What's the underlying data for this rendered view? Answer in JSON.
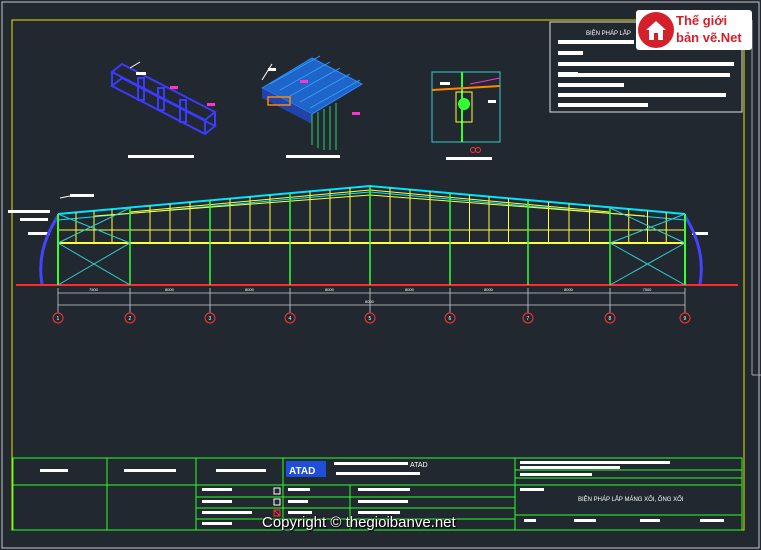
{
  "logo": {
    "line1": "Thế giới",
    "line2": "bản vẽ.Net"
  },
  "notes": {
    "title": "BIỆN PHÁP LẮP"
  },
  "titleblock": {
    "company": "ATAD",
    "stamp": "ATAD",
    "drawing_title": "BIỆN PHÁP LẮP MÁNG XỐI, ỐNG XỐI"
  },
  "watermark": "Copyright © thegioibanve.net",
  "elevation": {
    "total_dim": "8000",
    "bay_dims": [
      "7500",
      "8000",
      "8000",
      "8000",
      "8000",
      "8000",
      "8000",
      "7500"
    ],
    "grids": [
      "1",
      "2",
      "3",
      "4",
      "5",
      "6",
      "7",
      "8",
      "9"
    ]
  },
  "colors": {
    "background": "#212830",
    "frame": "#e6e600",
    "steel": "#ffff33",
    "column": "#33ff33",
    "bracing": "#33cccc",
    "roof": "#00e5ff",
    "ground": "#ff2a2a",
    "grid_bubble": "#ff3333",
    "titleblock": "#2aff2a"
  }
}
